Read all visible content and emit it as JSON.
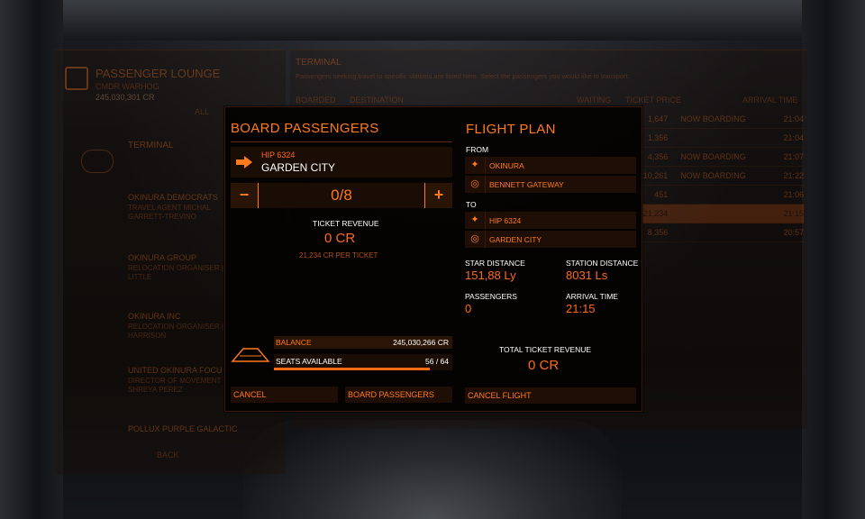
{
  "background": {
    "lounge_title": "PASSENGER LOUNGE",
    "lounge_sub": "CMDR WARHOG",
    "lounge_credits": "245,030,301 CR",
    "filter_all": "ALL",
    "terminal_left": "TERMINAL",
    "terminal_right": "TERMINAL",
    "terminal_desc": "Passengers seeking travel to specific stations are listed here. Select the passengers you would like to transport.",
    "col_boarded": "BOARDED",
    "col_destination": "DESTINATION",
    "col_waiting": "WAITING",
    "col_ticket_price": "TICKET PRICE",
    "col_arrival": "ARRIVAL TIME",
    "back_label": "BACK",
    "clients": [
      {
        "name": "OKINURA DEMOCRATS",
        "sub1": "TRAVEL AGENT MICHAL",
        "sub2": "GARRETT-TREVINO"
      },
      {
        "name": "OKINURA GROUP",
        "sub1": "RELOCATION ORGANISER |",
        "sub2": "LITTLE"
      },
      {
        "name": "OKINURA INC",
        "sub1": "RELOCATION ORGANISER |",
        "sub2": "HARRISON"
      },
      {
        "name": "UNITED OKINURA FOCU",
        "sub1": "DIRECTOR OF MOVEMENT",
        "sub2": "SHREYA PEREZ"
      },
      {
        "name": "POLLUX PURPLE GALACTIC",
        "sub1": "",
        "sub2": ""
      }
    ],
    "grid_rows": [
      {
        "price": "1,647",
        "status": "NOW BOARDING",
        "time": "21:04"
      },
      {
        "price": "1,356",
        "status": "",
        "time": "21:04"
      },
      {
        "price": "4,356",
        "status": "NOW BOARDING",
        "time": "21:07"
      },
      {
        "price": "10,261",
        "status": "NOW BOARDING",
        "time": "21:22"
      },
      {
        "price": "451",
        "status": "",
        "time": "21:06"
      },
      {
        "price": "21,234",
        "status": "",
        "time": "21:15"
      },
      {
        "price": "8,356",
        "status": "",
        "time": "20:57"
      }
    ]
  },
  "dialog": {
    "title": "BOARD PASSENGERS",
    "destination_system": "HIP 6324",
    "destination_station": "GARDEN CITY",
    "minus_label": "−",
    "plus_label": "+",
    "passenger_count": "0/8",
    "ticket_revenue_label": "TICKET REVENUE",
    "ticket_revenue_value": "0 CR",
    "per_ticket": "21,234 CR PER TICKET",
    "balance_label": "BALANCE",
    "balance_value": "245,030,266 CR",
    "seats_label": "SEATS AVAILABLE",
    "seats_value": "56 / 64",
    "seats_fraction": 0.875,
    "cancel_label": "CANCEL",
    "board_label": "BOARD PASSENGERS"
  },
  "flight_plan": {
    "title": "FLIGHT PLAN",
    "from_label": "FROM",
    "from_system": "OKINURA",
    "from_station": "BENNETT GATEWAY",
    "to_label": "TO",
    "to_system": "HIP 6324",
    "to_station": "GARDEN CITY",
    "star_distance_label": "STAR DISTANCE",
    "star_distance_value": "151,88 Ly",
    "station_distance_label": "STATION DISTANCE",
    "station_distance_value": "8031 Ls",
    "passengers_label": "PASSENGERS",
    "passengers_value": "0",
    "arrival_label": "ARRIVAL TIME",
    "arrival_value": "21:15",
    "total_revenue_label": "TOTAL TICKET REVENUE",
    "total_revenue_value": "0 CR",
    "cancel_flight_label": "CANCEL FLIGHT"
  },
  "colors": {
    "accent": "#ff7a1a",
    "panel": "#1e0e05",
    "text_white": "#ffffff"
  }
}
